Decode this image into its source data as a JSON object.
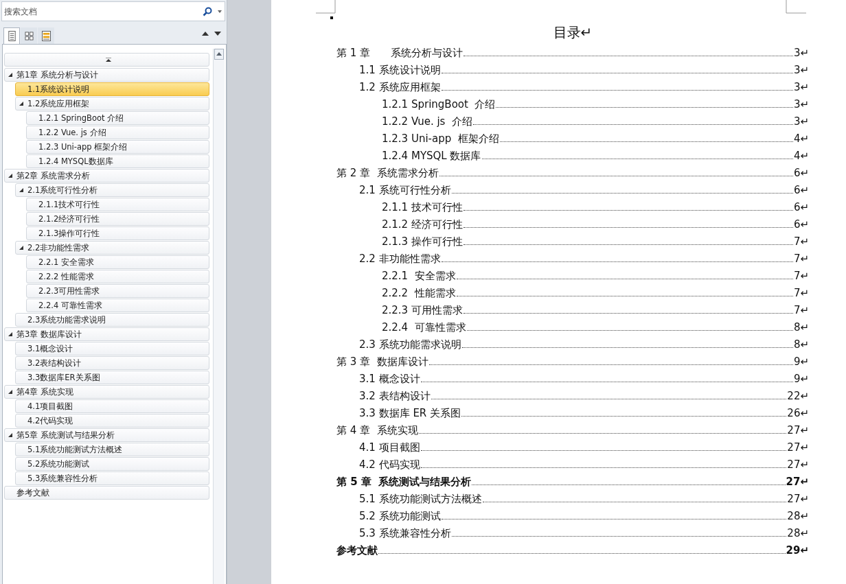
{
  "nav_pane": {
    "search": {
      "placeholder": "搜索文档"
    },
    "tabs": [
      {
        "selected": true
      },
      {
        "selected": false
      },
      {
        "selected": false
      }
    ],
    "tree": [
      {
        "label": "第1章 系统分析与设计",
        "expanded": true,
        "selected": false,
        "children": [
          {
            "label": "1.1系统设计说明",
            "selected": true
          },
          {
            "label": "1.2系统应用框架",
            "expanded": true,
            "selected": false,
            "children": [
              {
                "label": "1.2.1 SpringBoot 介绍",
                "selected": false
              },
              {
                "label": "1.2.2 Vue. js 介绍",
                "selected": false
              },
              {
                "label": "1.2.3 Uni-app 框架介绍",
                "selected": false
              },
              {
                "label": "1.2.4 MYSQL数据库",
                "selected": false
              }
            ]
          }
        ]
      },
      {
        "label": "第2章 系统需求分析",
        "expanded": true,
        "selected": false,
        "children": [
          {
            "label": "2.1系统可行性分析",
            "expanded": true,
            "selected": false,
            "children": [
              {
                "label": "2.1.1技术可行性",
                "selected": false
              },
              {
                "label": "2.1.2经济可行性",
                "selected": false
              },
              {
                "label": "2.1.3操作可行性",
                "selected": false
              }
            ]
          },
          {
            "label": "2.2非功能性需求",
            "expanded": true,
            "selected": false,
            "children": [
              {
                "label": "2.2.1 安全需求",
                "selected": false
              },
              {
                "label": "2.2.2 性能需求",
                "selected": false
              },
              {
                "label": "2.2.3可用性需求",
                "selected": false
              },
              {
                "label": "2.2.4 可靠性需求",
                "selected": false
              }
            ]
          },
          {
            "label": "2.3系统功能需求说明",
            "selected": false
          }
        ]
      },
      {
        "label": "第3章 数据库设计",
        "expanded": true,
        "selected": false,
        "children": [
          {
            "label": "3.1概念设计",
            "selected": false
          },
          {
            "label": "3.2表结构设计",
            "selected": false
          },
          {
            "label": "3.3数据库ER关系图",
            "selected": false
          }
        ]
      },
      {
        "label": "第4章 系统实现",
        "expanded": true,
        "selected": false,
        "children": [
          {
            "label": "4.1项目截图",
            "selected": false
          },
          {
            "label": "4.2代码实现",
            "selected": false
          }
        ]
      },
      {
        "label": "第5章 系统测试与结果分析",
        "expanded": true,
        "selected": false,
        "children": [
          {
            "label": "5.1系统功能测试方法概述",
            "selected": false
          },
          {
            "label": "5.2系统功能测试",
            "selected": false
          },
          {
            "label": "5.3系统兼容性分析",
            "selected": false
          }
        ]
      },
      {
        "label": "参考文献",
        "selected": false
      }
    ]
  },
  "document": {
    "title": "目录↵",
    "toc": [
      {
        "title": "第 1 章　　系统分析与设计",
        "page": "3↵",
        "bold": false,
        "children": [
          {
            "title": "1.1 系统设计说明",
            "page": "3↵",
            "bold": false
          },
          {
            "title": "1.2 系统应用框架",
            "page": "3↵",
            "bold": false,
            "children": [
              {
                "title": "1.2.1 SpringBoot  介绍",
                "page": "3↵",
                "bold": false
              },
              {
                "title": "1.2.2 Vue. js  介绍",
                "page": "3↵",
                "bold": false
              },
              {
                "title": "1.2.3 Uni-app  框架介绍",
                "page": "4↵",
                "bold": false
              },
              {
                "title": "1.2.4 MYSQL 数据库",
                "page": "4↵",
                "bold": false
              }
            ]
          }
        ]
      },
      {
        "title": "第 2 章  系统需求分析",
        "page": "6↵",
        "bold": false,
        "children": [
          {
            "title": "2.1 系统可行性分析",
            "page": "6↵",
            "bold": false,
            "children": [
              {
                "title": "2.1.1 技术可行性",
                "page": "6↵",
                "bold": false
              },
              {
                "title": "2.1.2 经济可行性",
                "page": "6↵",
                "bold": false
              },
              {
                "title": "2.1.3 操作可行性",
                "page": "7↵",
                "bold": false
              }
            ]
          },
          {
            "title": "2.2 非功能性需求",
            "page": "7↵",
            "bold": false,
            "children": [
              {
                "title": "2.2.1  安全需求",
                "page": "7↵",
                "bold": false
              },
              {
                "title": "2.2.2  性能需求",
                "page": "7↵",
                "bold": false
              },
              {
                "title": "2.2.3 可用性需求",
                "page": "7↵",
                "bold": false
              },
              {
                "title": "2.2.4  可靠性需求",
                "page": "8↵",
                "bold": false
              }
            ]
          },
          {
            "title": "2.3 系统功能需求说明",
            "page": "8↵",
            "bold": false
          }
        ]
      },
      {
        "title": "第 3 章  数据库设计",
        "page": "9↵",
        "bold": false,
        "children": [
          {
            "title": "3.1 概念设计",
            "page": "9↵",
            "bold": false
          },
          {
            "title": "3.2 表结构设计",
            "page": "22↵",
            "bold": false
          },
          {
            "title": "3.3 数据库 ER 关系图",
            "page": "26↵",
            "bold": false
          }
        ]
      },
      {
        "title": "第 4 章  系统实现",
        "page": "27↵",
        "bold": false,
        "children": [
          {
            "title": "4.1 项目截图",
            "page": "27↵",
            "bold": false
          },
          {
            "title": "4.2 代码实现",
            "page": "27↵",
            "bold": false
          }
        ]
      },
      {
        "title": "第 5 章  系统测试与结果分析",
        "page": "27↵",
        "bold": true,
        "children": [
          {
            "title": "5.1 系统功能测试方法概述",
            "page": "27↵",
            "bold": false
          },
          {
            "title": "5.2 系统功能测试",
            "page": "28↵",
            "bold": false
          },
          {
            "title": "5.3 系统兼容性分析",
            "page": "28↵",
            "bold": false
          }
        ]
      },
      {
        "title": "参考文献",
        "page": "29↵",
        "bold": true
      }
    ]
  }
}
